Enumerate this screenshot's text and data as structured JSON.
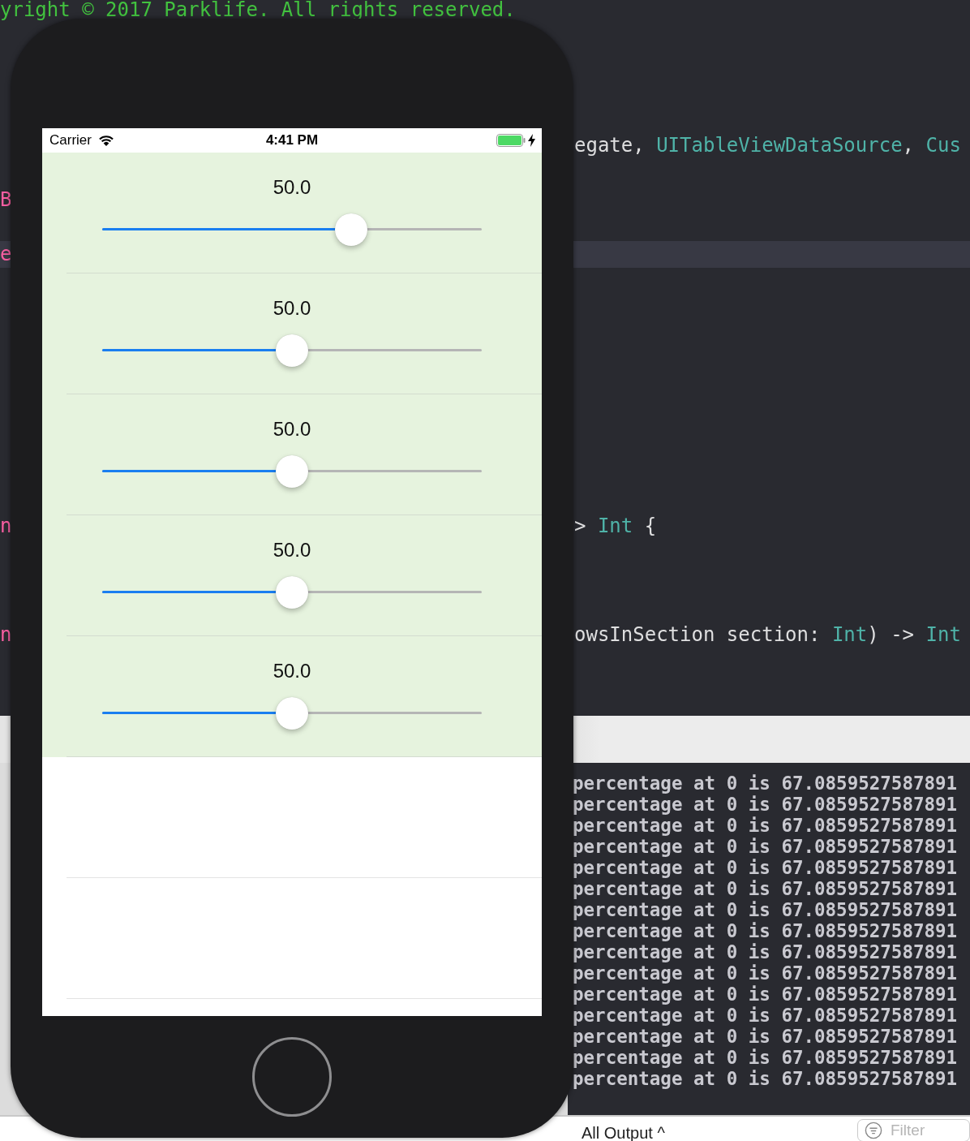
{
  "editor": {
    "lines": [
      {
        "kind": "code",
        "highlighted": false,
        "start": [
          {
            "kind": "comment",
            "text": "yright © 2017 Parklife. All rights reserved."
          }
        ]
      },
      {
        "kind": "blank"
      },
      {
        "kind": "blank"
      },
      {
        "kind": "blank"
      },
      {
        "kind": "blank"
      },
      {
        "kind": "code",
        "highlighted": false,
        "end": [
          {
            "kind": "plain",
            "text": "egate, "
          },
          {
            "kind": "type",
            "text": "UITableViewDataSource"
          },
          {
            "kind": "plain",
            "text": ", "
          },
          {
            "kind": "type",
            "text": "Cus"
          }
        ]
      },
      {
        "kind": "blank"
      },
      {
        "kind": "code",
        "highlighted": false,
        "start": [
          {
            "kind": "keyword",
            "text": "B"
          }
        ]
      },
      {
        "kind": "blank"
      },
      {
        "kind": "code",
        "highlighted": true,
        "start": [
          {
            "kind": "keyword",
            "text": "e"
          }
        ]
      },
      {
        "kind": "blank"
      },
      {
        "kind": "blank"
      },
      {
        "kind": "blank"
      },
      {
        "kind": "blank"
      },
      {
        "kind": "blank"
      },
      {
        "kind": "blank"
      },
      {
        "kind": "blank"
      },
      {
        "kind": "blank"
      },
      {
        "kind": "blank"
      },
      {
        "kind": "code",
        "highlighted": false,
        "start": [
          {
            "kind": "keyword",
            "text": "n"
          }
        ],
        "end": [
          {
            "kind": "plain",
            "text": "> "
          },
          {
            "kind": "type",
            "text": "Int"
          },
          {
            "kind": "plain",
            "text": " {"
          }
        ]
      },
      {
        "kind": "blank"
      },
      {
        "kind": "blank"
      },
      {
        "kind": "blank"
      },
      {
        "kind": "code",
        "highlighted": false,
        "start": [
          {
            "kind": "keyword",
            "text": "n"
          }
        ],
        "end": [
          {
            "kind": "plain",
            "text": "owsInSection section: "
          },
          {
            "kind": "type",
            "text": "Int"
          },
          {
            "kind": "plain",
            "text": ") -> "
          },
          {
            "kind": "type",
            "text": "Int"
          }
        ]
      }
    ]
  },
  "simulator": {
    "status_bar": {
      "carrier": "Carrier",
      "time": "4:41 PM",
      "battery": {
        "level": 1,
        "charging": true
      }
    },
    "rows": [
      {
        "kind": "slider",
        "label": "50.0",
        "level": 0.656
      },
      {
        "kind": "slider",
        "label": "50.0",
        "level": 0.5
      },
      {
        "kind": "slider",
        "label": "50.0",
        "level": 0.5
      },
      {
        "kind": "slider",
        "label": "50.0",
        "level": 0.5
      },
      {
        "kind": "slider",
        "label": "50.0",
        "level": 0.5
      },
      {
        "kind": "empty"
      },
      {
        "kind": "empty"
      }
    ]
  },
  "console": {
    "lines": [
      "percentage at 0 is 67.0859527587891",
      "percentage at 0 is 67.0859527587891",
      "percentage at 0 is 67.0859527587891",
      "percentage at 0 is 67.0859527587891",
      "percentage at 0 is 67.0859527587891",
      "percentage at 0 is 67.0859527587891",
      "percentage at 0 is 67.0859527587891",
      "percentage at 0 is 67.0859527587891",
      "percentage at 0 is 67.0859527587891",
      "percentage at 0 is 67.0859527587891",
      "percentage at 0 is 67.0859527587891",
      "percentage at 0 is 67.0859527587891",
      "percentage at 0 is 67.0859527587891",
      "percentage at 0 is 67.0859527587891",
      "percentage at 0 is 67.0859527587891"
    ],
    "output_menu": "All Output ^",
    "filter": {
      "placeholder": "Filter"
    }
  }
}
